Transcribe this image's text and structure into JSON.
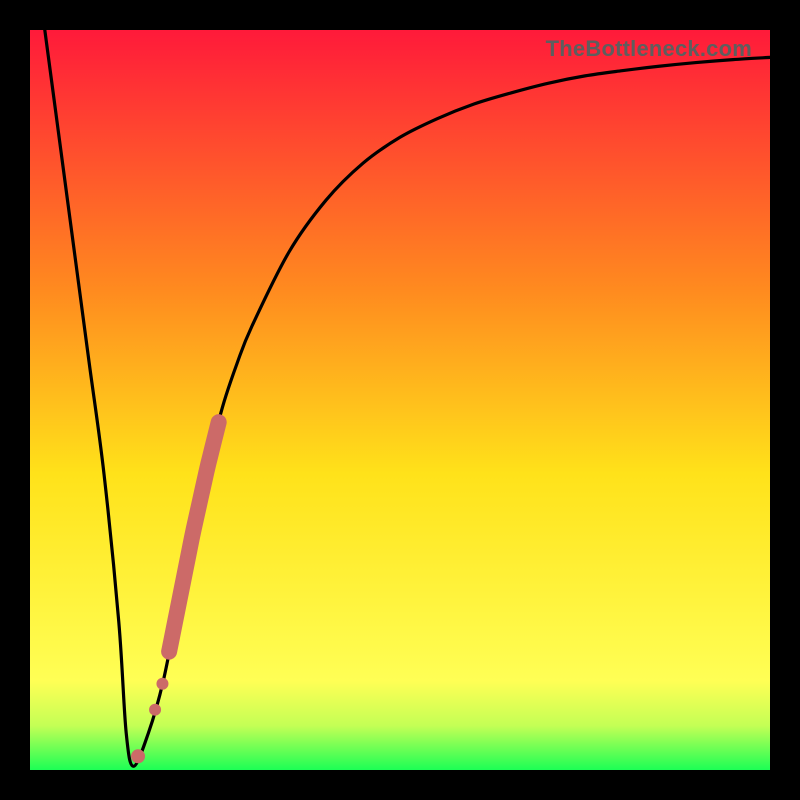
{
  "watermark": "TheBottleneck.com",
  "colors": {
    "frame": "#000000",
    "curve": "#000000",
    "markers": "#cc6a68",
    "gradient_top": "#ff1a3a",
    "gradient_mid_upper": "#ff8a1f",
    "gradient_mid": "#ffe21a",
    "gradient_lower": "#ffff55",
    "gradient_green_band": "#c4ff55",
    "gradient_bottom": "#1cff55"
  },
  "chart_data": {
    "type": "line",
    "title": "",
    "xlabel": "",
    "ylabel": "",
    "xlim": [
      0,
      100
    ],
    "ylim": [
      0,
      100
    ],
    "series": [
      {
        "name": "bottleneck-curve",
        "x": [
          2,
          4,
          6,
          8,
          10,
          12,
          13,
          14,
          16,
          18,
          20,
          22,
          24,
          26,
          28,
          30,
          35,
          40,
          45,
          50,
          55,
          60,
          65,
          70,
          75,
          80,
          85,
          90,
          95,
          100
        ],
        "y": [
          100,
          85,
          70,
          55,
          40,
          20,
          5,
          0.5,
          5,
          12,
          22,
          32,
          41,
          49,
          55,
          60,
          70,
          77,
          82,
          85.5,
          88,
          90,
          91.5,
          92.8,
          93.8,
          94.5,
          95.1,
          95.6,
          96,
          96.3
        ]
      }
    ],
    "optimum_x": 14,
    "markers": {
      "name": "highlighted-component-range",
      "x_start": 16.5,
      "x_end": 25.5,
      "note": "Thick salmon segment along the rising branch; small gap with two dots near the valley floor."
    }
  }
}
